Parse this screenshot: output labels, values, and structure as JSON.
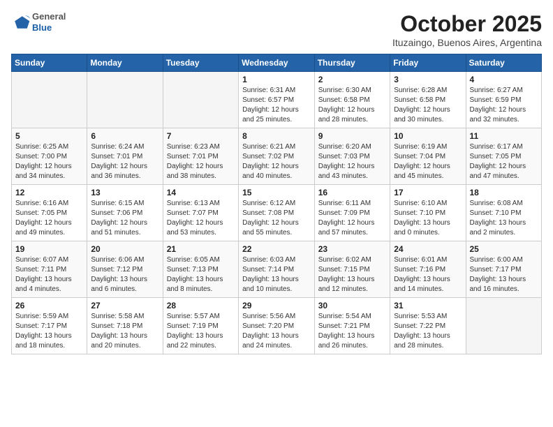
{
  "logo": {
    "general": "General",
    "blue": "Blue"
  },
  "header": {
    "month": "October 2025",
    "location": "Ituzaingo, Buenos Aires, Argentina"
  },
  "weekdays": [
    "Sunday",
    "Monday",
    "Tuesday",
    "Wednesday",
    "Thursday",
    "Friday",
    "Saturday"
  ],
  "weeks": [
    [
      {
        "day": "",
        "sunrise": "",
        "sunset": "",
        "daylight": ""
      },
      {
        "day": "",
        "sunrise": "",
        "sunset": "",
        "daylight": ""
      },
      {
        "day": "",
        "sunrise": "",
        "sunset": "",
        "daylight": ""
      },
      {
        "day": "1",
        "sunrise": "Sunrise: 6:31 AM",
        "sunset": "Sunset: 6:57 PM",
        "daylight": "Daylight: 12 hours and 25 minutes."
      },
      {
        "day": "2",
        "sunrise": "Sunrise: 6:30 AM",
        "sunset": "Sunset: 6:58 PM",
        "daylight": "Daylight: 12 hours and 28 minutes."
      },
      {
        "day": "3",
        "sunrise": "Sunrise: 6:28 AM",
        "sunset": "Sunset: 6:58 PM",
        "daylight": "Daylight: 12 hours and 30 minutes."
      },
      {
        "day": "4",
        "sunrise": "Sunrise: 6:27 AM",
        "sunset": "Sunset: 6:59 PM",
        "daylight": "Daylight: 12 hours and 32 minutes."
      }
    ],
    [
      {
        "day": "5",
        "sunrise": "Sunrise: 6:25 AM",
        "sunset": "Sunset: 7:00 PM",
        "daylight": "Daylight: 12 hours and 34 minutes."
      },
      {
        "day": "6",
        "sunrise": "Sunrise: 6:24 AM",
        "sunset": "Sunset: 7:01 PM",
        "daylight": "Daylight: 12 hours and 36 minutes."
      },
      {
        "day": "7",
        "sunrise": "Sunrise: 6:23 AM",
        "sunset": "Sunset: 7:01 PM",
        "daylight": "Daylight: 12 hours and 38 minutes."
      },
      {
        "day": "8",
        "sunrise": "Sunrise: 6:21 AM",
        "sunset": "Sunset: 7:02 PM",
        "daylight": "Daylight: 12 hours and 40 minutes."
      },
      {
        "day": "9",
        "sunrise": "Sunrise: 6:20 AM",
        "sunset": "Sunset: 7:03 PM",
        "daylight": "Daylight: 12 hours and 43 minutes."
      },
      {
        "day": "10",
        "sunrise": "Sunrise: 6:19 AM",
        "sunset": "Sunset: 7:04 PM",
        "daylight": "Daylight: 12 hours and 45 minutes."
      },
      {
        "day": "11",
        "sunrise": "Sunrise: 6:17 AM",
        "sunset": "Sunset: 7:05 PM",
        "daylight": "Daylight: 12 hours and 47 minutes."
      }
    ],
    [
      {
        "day": "12",
        "sunrise": "Sunrise: 6:16 AM",
        "sunset": "Sunset: 7:05 PM",
        "daylight": "Daylight: 12 hours and 49 minutes."
      },
      {
        "day": "13",
        "sunrise": "Sunrise: 6:15 AM",
        "sunset": "Sunset: 7:06 PM",
        "daylight": "Daylight: 12 hours and 51 minutes."
      },
      {
        "day": "14",
        "sunrise": "Sunrise: 6:13 AM",
        "sunset": "Sunset: 7:07 PM",
        "daylight": "Daylight: 12 hours and 53 minutes."
      },
      {
        "day": "15",
        "sunrise": "Sunrise: 6:12 AM",
        "sunset": "Sunset: 7:08 PM",
        "daylight": "Daylight: 12 hours and 55 minutes."
      },
      {
        "day": "16",
        "sunrise": "Sunrise: 6:11 AM",
        "sunset": "Sunset: 7:09 PM",
        "daylight": "Daylight: 12 hours and 57 minutes."
      },
      {
        "day": "17",
        "sunrise": "Sunrise: 6:10 AM",
        "sunset": "Sunset: 7:10 PM",
        "daylight": "Daylight: 13 hours and 0 minutes."
      },
      {
        "day": "18",
        "sunrise": "Sunrise: 6:08 AM",
        "sunset": "Sunset: 7:10 PM",
        "daylight": "Daylight: 13 hours and 2 minutes."
      }
    ],
    [
      {
        "day": "19",
        "sunrise": "Sunrise: 6:07 AM",
        "sunset": "Sunset: 7:11 PM",
        "daylight": "Daylight: 13 hours and 4 minutes."
      },
      {
        "day": "20",
        "sunrise": "Sunrise: 6:06 AM",
        "sunset": "Sunset: 7:12 PM",
        "daylight": "Daylight: 13 hours and 6 minutes."
      },
      {
        "day": "21",
        "sunrise": "Sunrise: 6:05 AM",
        "sunset": "Sunset: 7:13 PM",
        "daylight": "Daylight: 13 hours and 8 minutes."
      },
      {
        "day": "22",
        "sunrise": "Sunrise: 6:03 AM",
        "sunset": "Sunset: 7:14 PM",
        "daylight": "Daylight: 13 hours and 10 minutes."
      },
      {
        "day": "23",
        "sunrise": "Sunrise: 6:02 AM",
        "sunset": "Sunset: 7:15 PM",
        "daylight": "Daylight: 13 hours and 12 minutes."
      },
      {
        "day": "24",
        "sunrise": "Sunrise: 6:01 AM",
        "sunset": "Sunset: 7:16 PM",
        "daylight": "Daylight: 13 hours and 14 minutes."
      },
      {
        "day": "25",
        "sunrise": "Sunrise: 6:00 AM",
        "sunset": "Sunset: 7:17 PM",
        "daylight": "Daylight: 13 hours and 16 minutes."
      }
    ],
    [
      {
        "day": "26",
        "sunrise": "Sunrise: 5:59 AM",
        "sunset": "Sunset: 7:17 PM",
        "daylight": "Daylight: 13 hours and 18 minutes."
      },
      {
        "day": "27",
        "sunrise": "Sunrise: 5:58 AM",
        "sunset": "Sunset: 7:18 PM",
        "daylight": "Daylight: 13 hours and 20 minutes."
      },
      {
        "day": "28",
        "sunrise": "Sunrise: 5:57 AM",
        "sunset": "Sunset: 7:19 PM",
        "daylight": "Daylight: 13 hours and 22 minutes."
      },
      {
        "day": "29",
        "sunrise": "Sunrise: 5:56 AM",
        "sunset": "Sunset: 7:20 PM",
        "daylight": "Daylight: 13 hours and 24 minutes."
      },
      {
        "day": "30",
        "sunrise": "Sunrise: 5:54 AM",
        "sunset": "Sunset: 7:21 PM",
        "daylight": "Daylight: 13 hours and 26 minutes."
      },
      {
        "day": "31",
        "sunrise": "Sunrise: 5:53 AM",
        "sunset": "Sunset: 7:22 PM",
        "daylight": "Daylight: 13 hours and 28 minutes."
      },
      {
        "day": "",
        "sunrise": "",
        "sunset": "",
        "daylight": ""
      }
    ]
  ]
}
